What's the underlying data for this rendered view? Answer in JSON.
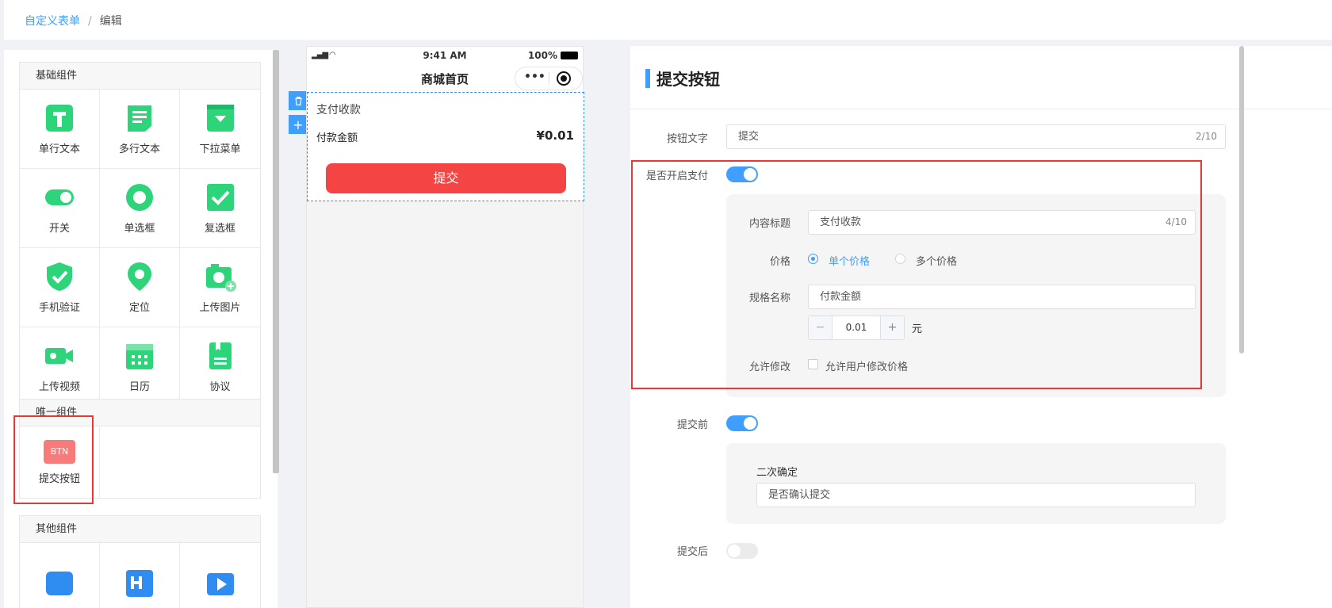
{
  "breadcrumb": {
    "root": "自定义表单",
    "current": "编辑"
  },
  "palette": {
    "basic_title": "基础组件",
    "basic_items": [
      {
        "label": "单行文本",
        "icon": "single-line-text-icon"
      },
      {
        "label": "多行文本",
        "icon": "multi-line-text-icon"
      },
      {
        "label": "下拉菜单",
        "icon": "dropdown-menu-icon"
      },
      {
        "label": "开关",
        "icon": "switch-icon"
      },
      {
        "label": "单选框",
        "icon": "radio-icon"
      },
      {
        "label": "复选框",
        "icon": "checkbox-icon"
      },
      {
        "label": "手机验证",
        "icon": "phone-verify-icon"
      },
      {
        "label": "定位",
        "icon": "location-icon"
      },
      {
        "label": "上传图片",
        "icon": "upload-image-icon"
      },
      {
        "label": "上传视频",
        "icon": "upload-video-icon"
      },
      {
        "label": "日历",
        "icon": "calendar-icon"
      },
      {
        "label": "协议",
        "icon": "agreement-icon"
      }
    ],
    "unique_title": "唯一组件",
    "unique_items": [
      {
        "label": "提交按钮",
        "badge": "BTN",
        "icon": "submit-button-icon"
      }
    ],
    "other_title": "其他组件"
  },
  "phone": {
    "time": "9:41 AM",
    "battery": "100%",
    "nav_title": "商城首页",
    "pay_title": "支付收款",
    "amount_label": "付款金额",
    "amount_value": "¥0.01",
    "submit_label": "提交"
  },
  "settings": {
    "title": "提交按钮",
    "button_text_label": "按钮文字",
    "button_text_value": "提交",
    "button_text_count": "2/10",
    "enable_pay_label": "是否开启支付",
    "enable_pay_on": true,
    "content_title_label": "内容标题",
    "content_title_value": "支付收款",
    "content_title_count": "4/10",
    "price_label": "价格",
    "price_option_single": "单个价格",
    "price_option_multi": "多个价格",
    "spec_name_label": "规格名称",
    "spec_name_value": "付款金额",
    "price_value": "0.01",
    "price_unit": "元",
    "allow_edit_label": "允许修改",
    "allow_edit_option": "允许用户修改价格",
    "before_submit_label": "提交前",
    "before_submit_on": true,
    "confirm_label": "二次确定",
    "confirm_value": "是否确认提交",
    "after_submit_label": "提交后",
    "after_submit_on": false
  },
  "colors": {
    "accent": "#409eff",
    "submit": "#f44444",
    "icon_green": "#2ed47a",
    "highlight": "#e53935"
  }
}
